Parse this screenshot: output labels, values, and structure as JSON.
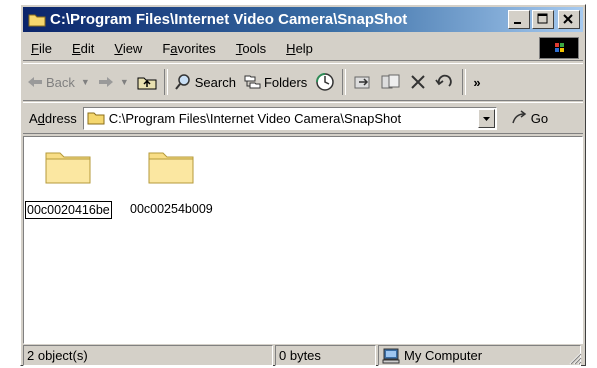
{
  "window": {
    "title": "C:\\Program Files\\Internet Video Camera\\SnapShot",
    "controls": {
      "minimize": "minimize",
      "maximize": "maximize",
      "close": "close"
    }
  },
  "menu": {
    "items": [
      "File",
      "Edit",
      "View",
      "Favorites",
      "Tools",
      "Help"
    ]
  },
  "toolbar": {
    "back_label": "Back",
    "search_label": "Search",
    "folders_label": "Folders",
    "overflow_label": "»"
  },
  "address": {
    "label": "Address",
    "value": "C:\\Program Files\\Internet Video Camera\\SnapShot",
    "go_label": "Go"
  },
  "files": [
    {
      "name": "00c0020416be",
      "selected": true
    },
    {
      "name": "00c00254b009",
      "selected": false
    }
  ],
  "status": {
    "objects": "2 object(s)",
    "size": "0 bytes",
    "zone": "My Computer"
  },
  "colors": {
    "title_active_start": "#0a246a",
    "title_active_end": "#a6caf0",
    "chrome": "#d4d0c8",
    "folder": "#f5d76e"
  }
}
